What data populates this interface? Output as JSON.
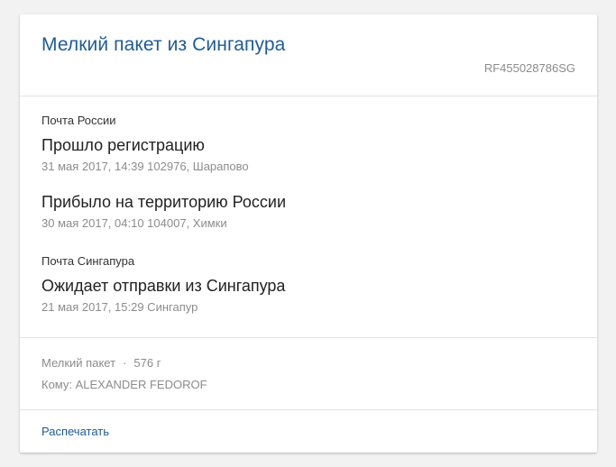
{
  "card": {
    "title": "Мелкий пакет из Сингапура",
    "tracking_number": "RF455028786SG"
  },
  "groups": [
    {
      "carrier": "Почта России",
      "events": [
        {
          "title": "Прошло регистрацию",
          "meta": "31 мая 2017, 14:39 102976, Шарапово"
        },
        {
          "title": "Прибыло на территорию России",
          "meta": "30 мая 2017, 04:10 104007, Химки"
        }
      ]
    },
    {
      "carrier": "Почта Сингапура",
      "events": [
        {
          "title": "Ожидает отправки из Сингапура",
          "meta": "21 мая 2017, 15:29 Сингапур"
        }
      ]
    }
  ],
  "details": {
    "type": "Мелкий пакет",
    "separator": "·",
    "weight": "576 г",
    "recipient": "Кому: ALEXANDER FEDOROF"
  },
  "footer": {
    "print_label": "Распечатать"
  },
  "colors": {
    "accent": "#1d5b9b",
    "muted_text": "#8c8c8c",
    "primary_text": "#222222",
    "background": "#f2f2f2",
    "card": "#ffffff",
    "divider": "#e3e3e3"
  }
}
